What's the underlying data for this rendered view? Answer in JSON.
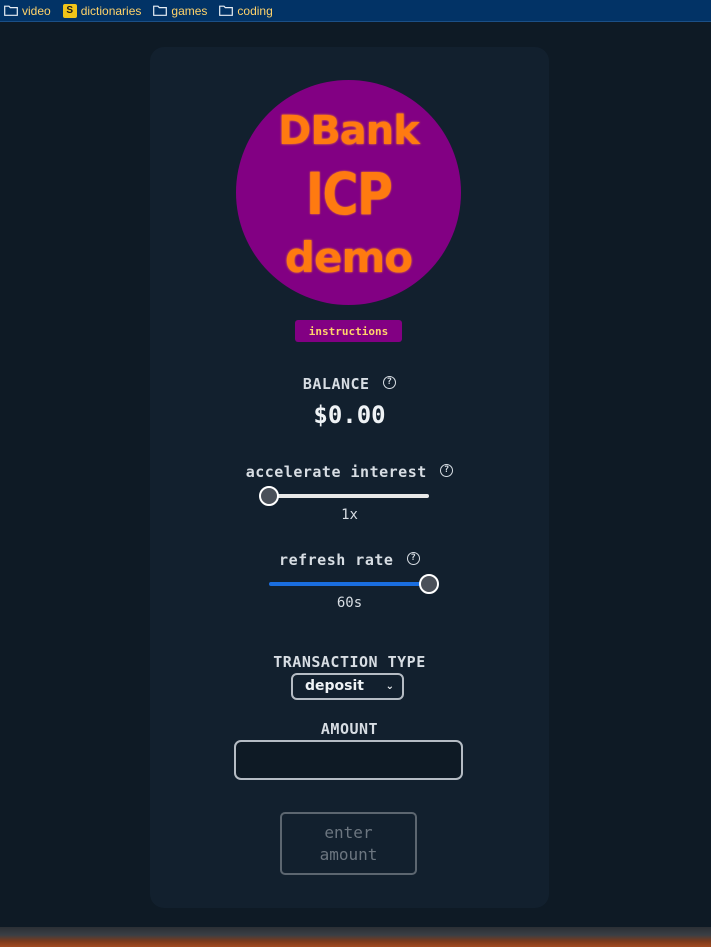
{
  "bookmarks": [
    {
      "label": "video",
      "icon": "folder-icon"
    },
    {
      "label": "dictionaries",
      "icon": "s-favicon"
    },
    {
      "label": "games",
      "icon": "folder-icon"
    },
    {
      "label": "coding",
      "icon": "folder-icon"
    }
  ],
  "favicon_letter": "S",
  "logo": {
    "line1": "DBank",
    "line2": "ICP",
    "line3": "demo",
    "bg_color": "#820083",
    "text_color": "#ff7a10"
  },
  "instructions_label": "instructions",
  "balance": {
    "label": "BALANCE",
    "value": "$0.00"
  },
  "accelerate": {
    "label": "accelerate interest",
    "value_text": "1x",
    "level": 0.0
  },
  "refresh": {
    "label": "refresh rate",
    "value_text": "60s",
    "level": 1.0
  },
  "help_icon_glyph": "?",
  "transaction": {
    "label": "TRANSACTION TYPE",
    "selected": "deposit"
  },
  "amount": {
    "label": "AMOUNT",
    "value": ""
  },
  "submit_label": "enter\namount",
  "colors": {
    "accent_blue": "#1a6ee0",
    "track_light": "#e8e8e8"
  }
}
